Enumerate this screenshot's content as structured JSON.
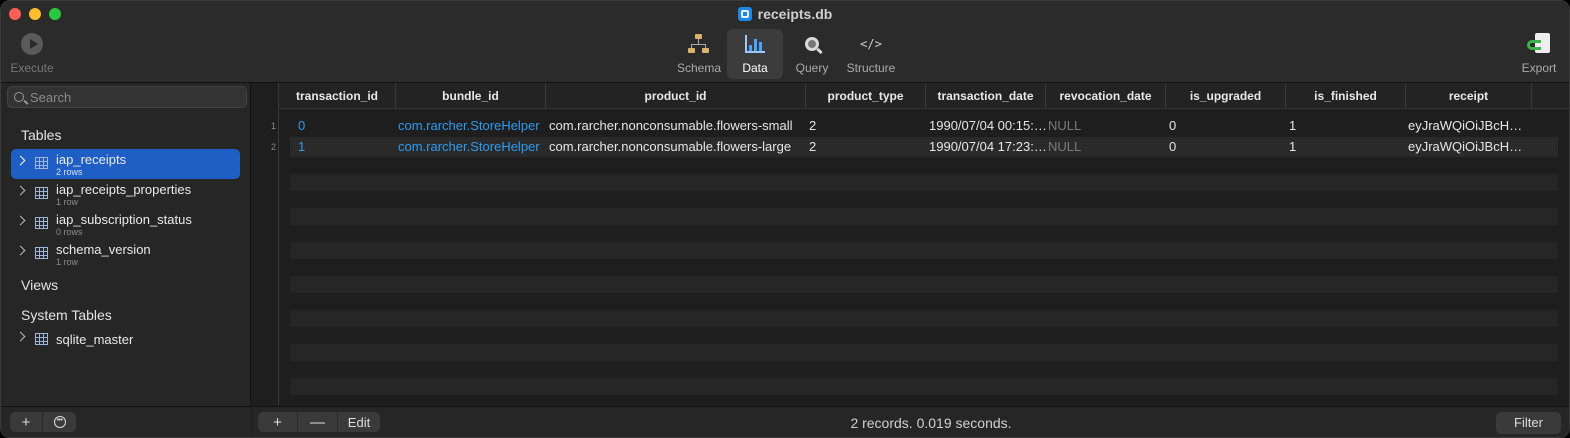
{
  "window": {
    "title": "receipts.db"
  },
  "toolbar": {
    "execute": "Execute",
    "schema": "Schema",
    "data": "Data",
    "query": "Query",
    "structure": "Structure",
    "structure_glyph": "</>",
    "export": "Export"
  },
  "sidebar": {
    "search_placeholder": "Search",
    "tables_heading": "Tables",
    "tables": [
      {
        "name": "iap_receipts",
        "rows": "2 rows"
      },
      {
        "name": "iap_receipts_properties",
        "rows": "1 row"
      },
      {
        "name": "iap_subscription_status",
        "rows": "0 rows"
      },
      {
        "name": "schema_version",
        "rows": "1 row"
      }
    ],
    "views_heading": "Views",
    "system_heading": "System Tables",
    "system_tables": [
      {
        "name": "sqlite_master"
      }
    ],
    "add_label": "+"
  },
  "grid": {
    "columns": [
      "transaction_id",
      "bundle_id",
      "product_id",
      "product_type",
      "transaction_date",
      "revocation_date",
      "is_upgraded",
      "is_finished",
      "receipt"
    ],
    "rows": [
      {
        "num": "1",
        "transaction_id": "0",
        "bundle_id": "com.rarcher.StoreHelper",
        "product_id": "com.rarcher.nonconsumable.flowers-small",
        "product_type": "2",
        "transaction_date": "1990/07/04 00:15:…",
        "revocation_date": "NULL",
        "is_upgraded": "0",
        "is_finished": "1",
        "receipt": "eyJraWQiOiJBcH…"
      },
      {
        "num": "2",
        "transaction_id": "1",
        "bundle_id": "com.rarcher.StoreHelper",
        "product_id": "com.rarcher.nonconsumable.flowers-large",
        "product_type": "2",
        "transaction_date": "1990/07/04 17:23:…",
        "revocation_date": "NULL",
        "is_upgraded": "0",
        "is_finished": "1",
        "receipt": "eyJraWQiOiJBcH…"
      }
    ]
  },
  "footer": {
    "add_label": "+",
    "remove_label": "—",
    "edit_label": "Edit",
    "status": "2 records. 0.019 seconds.",
    "filter_label": "Filter"
  },
  "colors": {
    "accent": "#1f5fc5",
    "link": "#2d9bf0",
    "null": "#7a7a7a",
    "close": "#fe5f57",
    "minimize": "#febc2e",
    "maximize": "#28c840"
  }
}
